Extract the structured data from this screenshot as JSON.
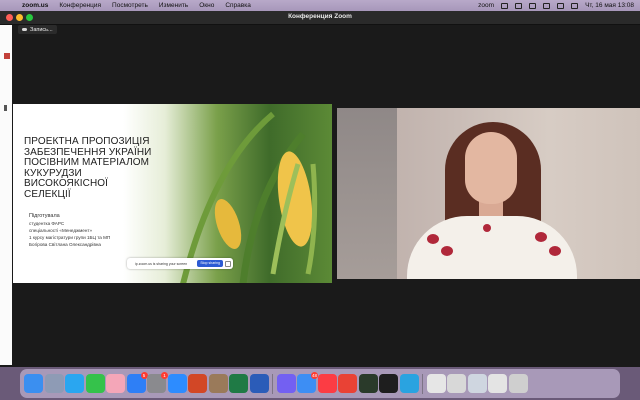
{
  "menubar": {
    "app_name": "zoom.us",
    "items": [
      "Конференция",
      "Посмотреть",
      "Изменить",
      "Окно",
      "Справка"
    ],
    "status_zoom": "zoom",
    "clock": "Чт, 16 мая  13:08"
  },
  "window": {
    "title": "Конференция Zoom",
    "recording_label": "Запись..."
  },
  "slide": {
    "title_lines": [
      "ПРОЕКТНА ПРОПОЗИЦІЯ",
      "ЗАБЕЗПЕЧЕННЯ УКРАЇНИ",
      "ПОСІВНИМ МАТЕРІАЛОМ",
      "КУКУРУДЗИ",
      "ВИСОКОЯКІСНОЇ",
      "СЕЛЕКЦІЇ"
    ],
    "sub_heading": "Підготувала",
    "sub_lines": [
      "студентка ФАРС",
      "спеціальності «Менеджмент»",
      "1 курсу магістратури групи 1БЦ та МП",
      "Богірова Світлана Олександрівна"
    ],
    "share_text": "ip.zoom.us is sharing your screen",
    "stop_sharing": "Stop sharing"
  },
  "dock": {
    "icons": [
      {
        "name": "finder-icon",
        "color": "#3b8ff0"
      },
      {
        "name": "launchpad-icon",
        "color": "#8e9bb5"
      },
      {
        "name": "safari-icon",
        "color": "#2aa6f0"
      },
      {
        "name": "facetime-icon",
        "color": "#35c24b"
      },
      {
        "name": "photos-icon",
        "color": "#f4a6b8"
      },
      {
        "name": "app-store-icon",
        "color": "#2e7ff6",
        "badge": "5"
      },
      {
        "name": "system-settings-icon",
        "color": "#8a8a8e",
        "badge": "1"
      },
      {
        "name": "zoom-icon",
        "color": "#2d8cff"
      },
      {
        "name": "powerpoint-icon",
        "color": "#d24726"
      },
      {
        "name": "archive-utility-icon",
        "color": "#9a7a5a"
      },
      {
        "name": "excel-icon",
        "color": "#1f7a45"
      },
      {
        "name": "word-icon",
        "color": "#2b5cb8"
      },
      {
        "name": "viber-icon",
        "color": "#7360f2"
      },
      {
        "name": "mail-icon",
        "color": "#3d8ef4",
        "badge": "48"
      },
      {
        "name": "music-icon",
        "color": "#fc3c44"
      },
      {
        "name": "chrome-icon",
        "color": "#e94235"
      },
      {
        "name": "activity-monitor-icon",
        "color": "#2a3a2a"
      },
      {
        "name": "terminal-icon",
        "color": "#1e1e1e"
      },
      {
        "name": "telegram-icon",
        "color": "#2aa3e0"
      },
      {
        "name": "document-icon",
        "color": "#e6e6e6"
      },
      {
        "name": "downloads-icon",
        "color": "#d8d8d8"
      },
      {
        "name": "screenshot-icon",
        "color": "#cfd6e0"
      },
      {
        "name": "folder-icon",
        "color": "#e4e4e4"
      },
      {
        "name": "trash-icon",
        "color": "#cfcfcf"
      }
    ]
  }
}
